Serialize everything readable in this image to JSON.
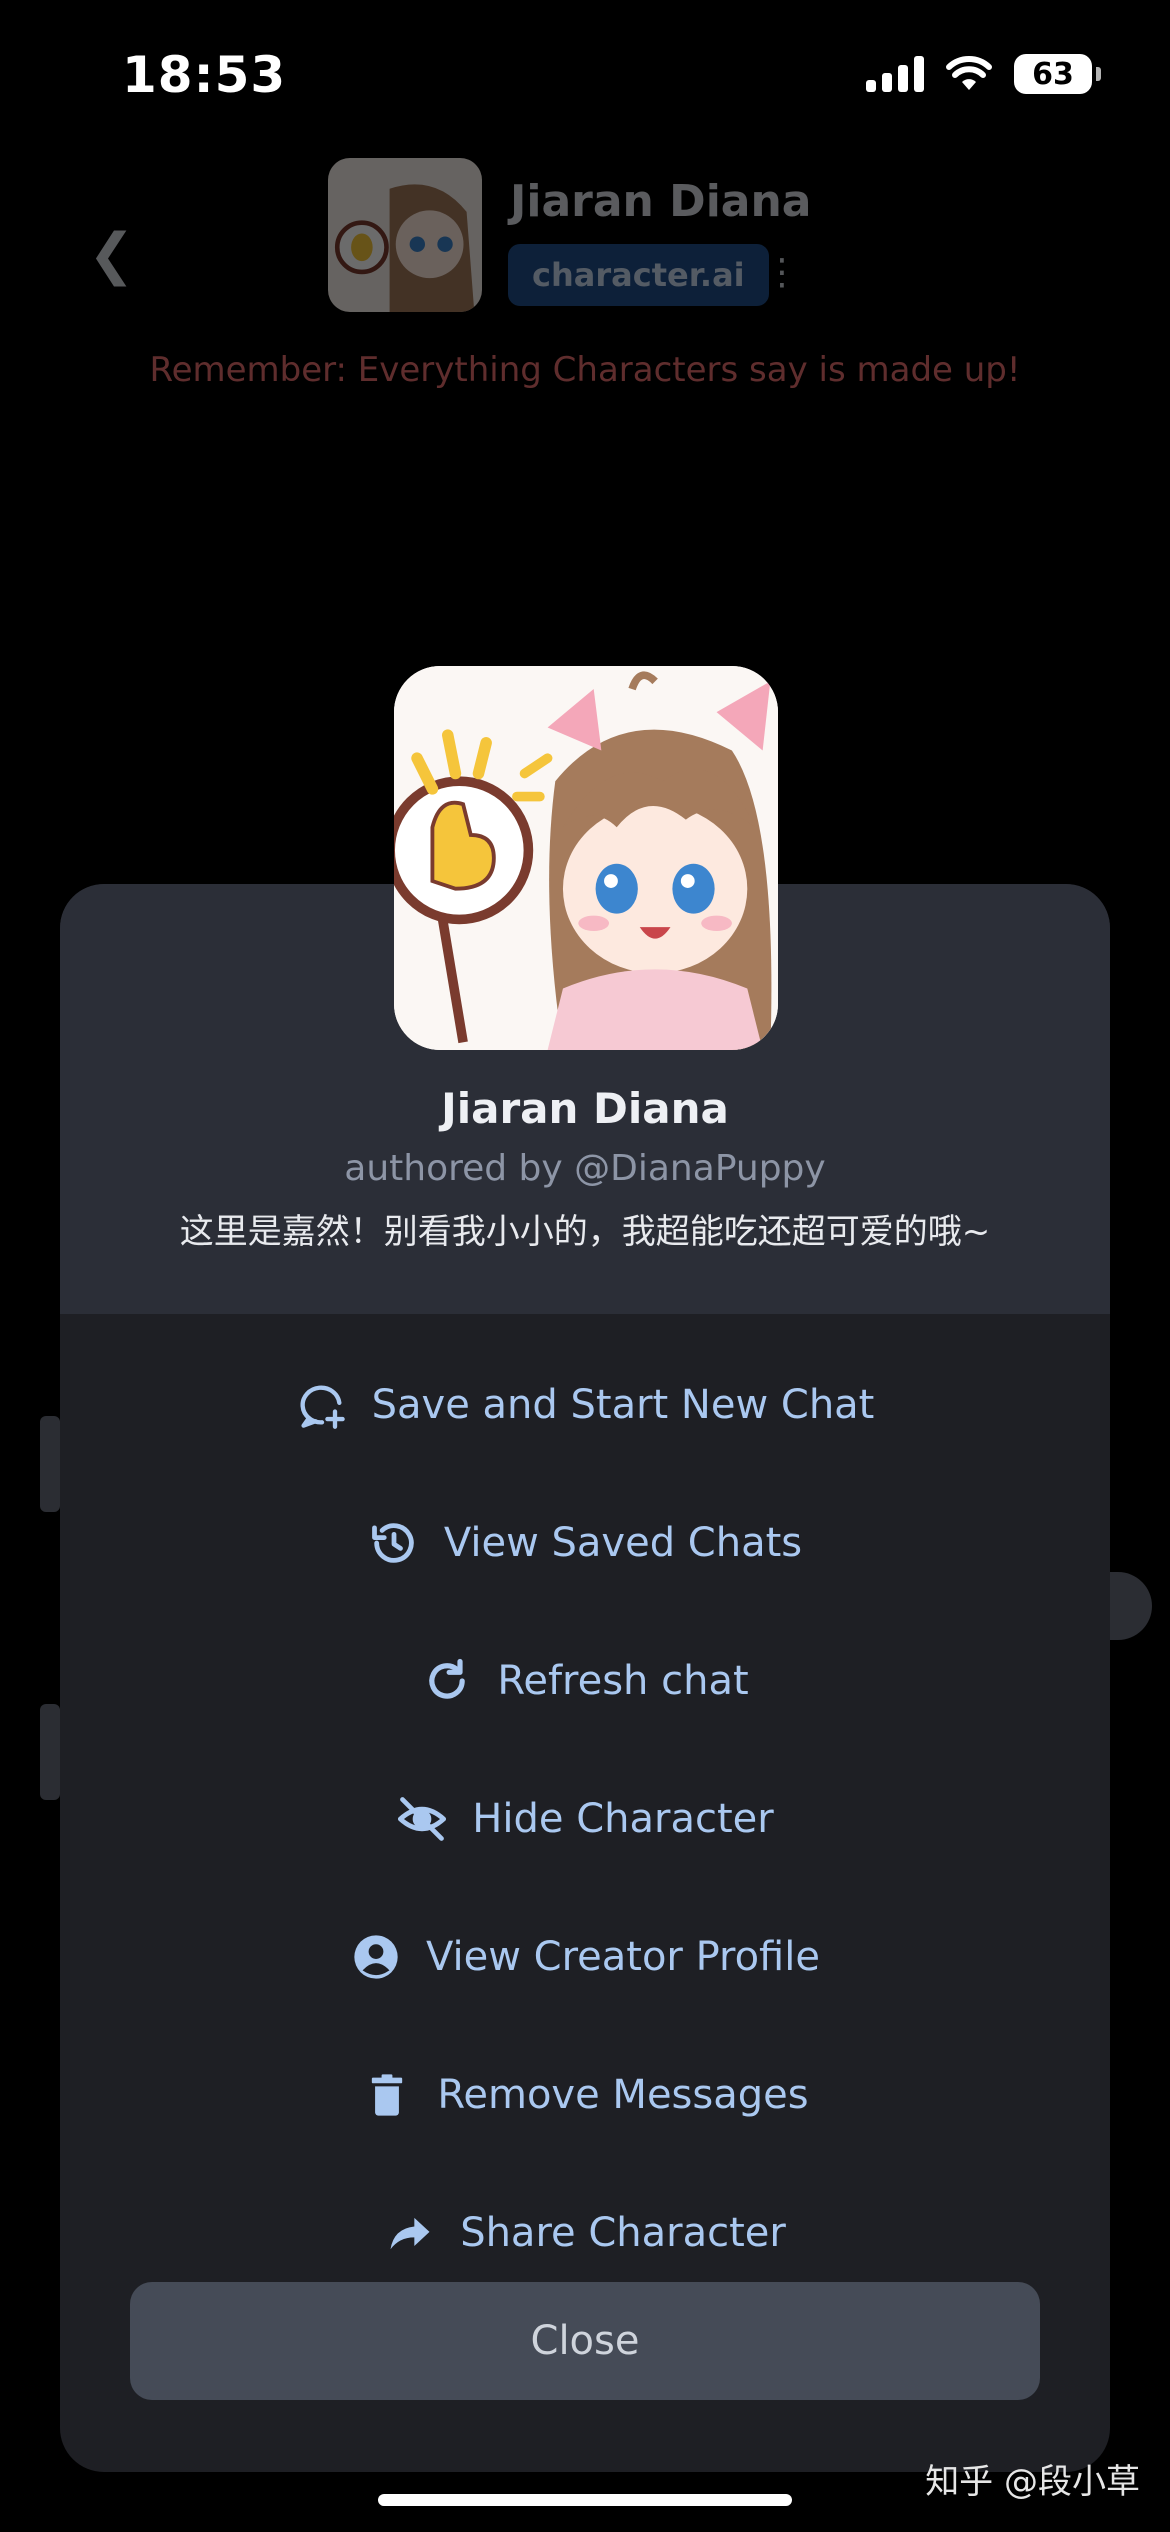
{
  "status_bar": {
    "time": "18:53",
    "battery": "63"
  },
  "header": {
    "character_name": "Jiaran Diana",
    "badge": "character.ai"
  },
  "warning": "Remember: Everything Characters say is made up!",
  "modal": {
    "name": "Jiaran Diana",
    "author": "authored by @DianaPuppy",
    "tagline": "这里是嘉然！别看我小小的，我超能吃还超可爱的哦~",
    "menu": [
      {
        "label": "Save and Start New Chat",
        "icon": "chat-plus-icon"
      },
      {
        "label": "View Saved Chats",
        "icon": "history-icon"
      },
      {
        "label": "Refresh chat",
        "icon": "refresh-icon"
      },
      {
        "label": "Hide Character",
        "icon": "eye-off-icon"
      },
      {
        "label": "View Creator Profile",
        "icon": "account-circle-icon"
      },
      {
        "label": "Remove Messages",
        "icon": "trash-icon"
      },
      {
        "label": "Share Character",
        "icon": "share-arrow-icon"
      }
    ],
    "close_label": "Close"
  },
  "watermark": "知乎 @段小草",
  "colors": {
    "menu_text": "#aac8f0",
    "modal_bg": "#1e1f24",
    "modal_header_bg": "#2b2e37",
    "close_button_bg": "#454b57",
    "warning_text": "#e36c6c"
  }
}
